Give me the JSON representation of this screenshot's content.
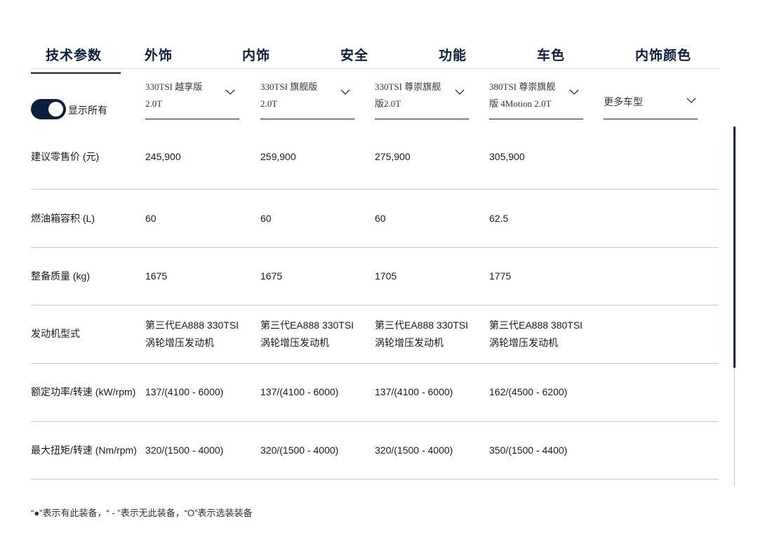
{
  "tabs": [
    {
      "label": "技术参数",
      "active": true
    },
    {
      "label": "外饰"
    },
    {
      "label": "内饰"
    },
    {
      "label": "安全"
    },
    {
      "label": "功能"
    },
    {
      "label": "车色"
    },
    {
      "label": "内饰颜色"
    }
  ],
  "toggle": {
    "label": "显示所有",
    "on": true
  },
  "models": [
    "330TSI 越享版\n2.0T",
    "330TSI 旗舰版\n2.0T",
    "330TSI 尊崇旗舰\n版2.0T",
    "380TSI 尊崇旗舰\n版 4Motion 2.0T",
    "更多车型"
  ],
  "specs": [
    {
      "label": "建议零售价 (元)",
      "values": [
        "245,900",
        "259,900",
        "275,900",
        "305,900"
      ]
    },
    {
      "label": "燃油箱容积 (L)",
      "values": [
        "60",
        "60",
        "60",
        "62.5"
      ]
    },
    {
      "label": "整备质量 (kg)",
      "values": [
        "1675",
        "1675",
        "1705",
        "1775"
      ]
    },
    {
      "label": "发动机型式",
      "values": [
        "第三代EA888 330TSI\n涡轮增压发动机",
        "第三代EA888 330TSI\n涡轮增压发动机",
        "第三代EA888 330TSI\n涡轮增压发动机",
        "第三代EA888 380TSI\n涡轮增压发动机"
      ]
    },
    {
      "label": "额定功率/转速 (kW/rpm)",
      "values": [
        "137/(4100 - 6000)",
        "137/(4100 - 6000)",
        "137/(4100 - 6000)",
        "162/(4500 - 6200)"
      ]
    },
    {
      "label": "最大扭矩/转速 (Nm/rpm)",
      "values": [
        "320/(1500 - 4000)",
        "320/(1500 - 4000)",
        "320/(1500 - 4000)",
        "350/(1500 - 4400)"
      ]
    }
  ],
  "footnote": "“●”表示有此装备，“ - ”表示无此装备，“O”表示选装装备",
  "colors": {
    "accent": "#0b1f3f",
    "divider": "#c9c9c9"
  }
}
